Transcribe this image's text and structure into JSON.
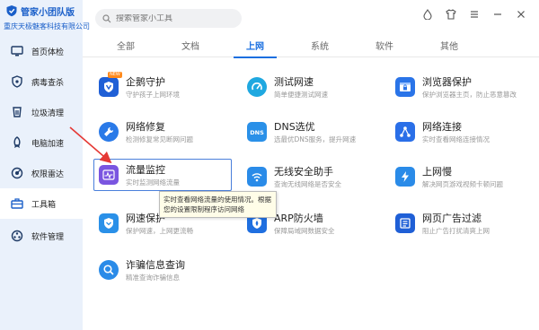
{
  "brand": {
    "title": "管家小团队版",
    "subtitle": "重庆天极魅客科技有限公司"
  },
  "sidebar": {
    "items": [
      {
        "label": "首页体检",
        "icon": "monitor-icon"
      },
      {
        "label": "病毒查杀",
        "icon": "shield-icon"
      },
      {
        "label": "垃圾清理",
        "icon": "broom-icon"
      },
      {
        "label": "电脑加速",
        "icon": "rocket-icon"
      },
      {
        "label": "权限雷达",
        "icon": "radar-icon"
      },
      {
        "label": "工具箱",
        "icon": "toolbox-icon"
      },
      {
        "label": "软件管理",
        "icon": "app-store-icon"
      }
    ],
    "active_index": 5
  },
  "search": {
    "placeholder": "搜索管家小工具"
  },
  "tabs": [
    {
      "label": "全部"
    },
    {
      "label": "文档"
    },
    {
      "label": "上网"
    },
    {
      "label": "系统"
    },
    {
      "label": "软件"
    },
    {
      "label": "其他"
    }
  ],
  "active_tab": 2,
  "tools": [
    {
      "name": "企鹅守护",
      "desc": "守护孩子上网环境",
      "badge": "NEW",
      "color": "#1f5fd6"
    },
    {
      "name": "测试网速",
      "desc": "简单便捷测试网速",
      "color": "#1fa8e0"
    },
    {
      "name": "浏览器保护",
      "desc": "保护浏览器主页，防止恶意篡改",
      "color": "#2a74e8"
    },
    {
      "name": "网络修复",
      "desc": "检测修复常见断网问题",
      "color": "#2a7ae8"
    },
    {
      "name": "DNS选优",
      "desc": "选最优DNS服务，提升网速",
      "color": "#2a90e8"
    },
    {
      "name": "网络连接",
      "desc": "实时查看网络连接情况",
      "color": "#2a6fe8"
    },
    {
      "name": "流量监控",
      "desc": "实时监测网络流量",
      "color": "#7a55e0"
    },
    {
      "name": "无线安全助手",
      "desc": "查询无线网络是否安全",
      "color": "#2a8be8"
    },
    {
      "name": "上网慢",
      "desc": "解决网页游戏视频卡顿问题",
      "color": "#2a8be8"
    },
    {
      "name": "网速保护",
      "desc": "保护网速，上网更流畅",
      "color": "#2a90e8"
    },
    {
      "name": "ARP防火墙",
      "desc": "保障局域网数据安全",
      "color": "#1f6fe0"
    },
    {
      "name": "网页广告过滤",
      "desc": "阻止广告打扰清爽上网",
      "color": "#1f5fd6"
    },
    {
      "name": "诈骗信息查询",
      "desc": "精准查询诈骗信息",
      "color": "#2a8be8"
    }
  ],
  "tooltip": {
    "text": "实时查看网络流量的使用情况。根据您的设置限制程序访问网络"
  },
  "window_controls": [
    "skin-icon",
    "shirt-icon",
    "menu-icon",
    "minimize-icon",
    "close-icon"
  ]
}
